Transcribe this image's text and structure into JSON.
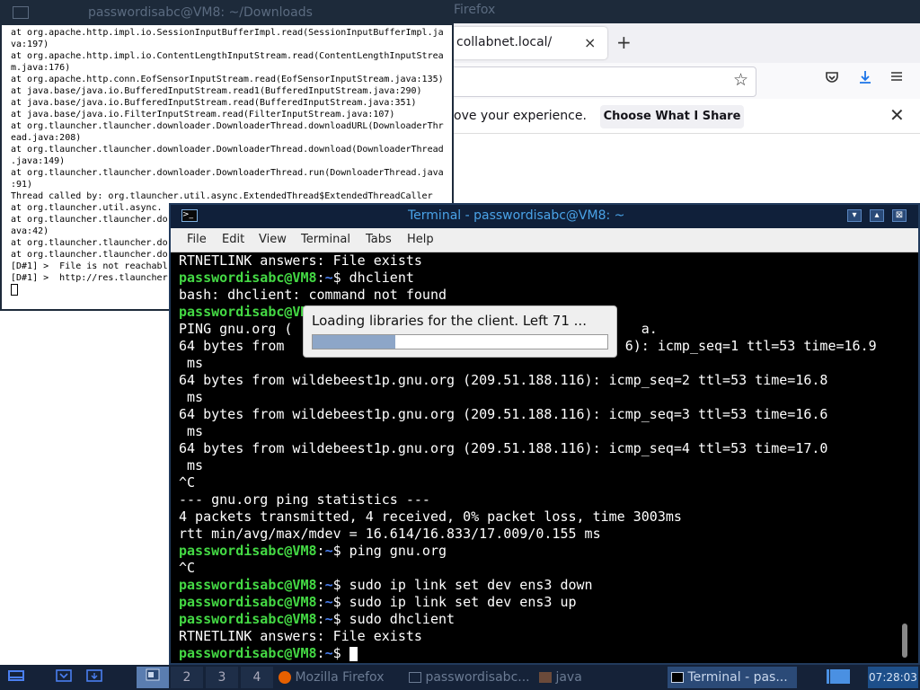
{
  "firefox": {
    "window_title": "Firefox",
    "tab_label": "collabnet.local/",
    "tab_close": "×",
    "new_tab": "+",
    "notification_text": "ove your experience.",
    "choose_button": "Choose What I Share",
    "notification_close": "✕"
  },
  "xterm": {
    "title": "passwordisabc@VM8: ~/Downloads",
    "lines": [
      "at org.apache.http.impl.io.SessionInputBufferImpl.read(SessionInputBufferImpl.ja",
      "va:197)",
      "at org.apache.http.impl.io.ContentLengthInputStream.read(ContentLengthInputStrea",
      "m.java:176)",
      "at org.apache.http.conn.EofSensorInputStream.read(EofSensorInputStream.java:135)",
      "at java.base/java.io.BufferedInputStream.read1(BufferedInputStream.java:290)",
      "at java.base/java.io.BufferedInputStream.read(BufferedInputStream.java:351)",
      "at java.base/java.io.FilterInputStream.read(FilterInputStream.java:107)",
      "at org.tlauncher.tlauncher.downloader.DownloaderThread.downloadURL(DownloaderThr",
      "ead.java:208)",
      "at org.tlauncher.tlauncher.downloader.DownloaderThread.download(DownloaderThread",
      ".java:149)",
      "at org.tlauncher.tlauncher.downloader.DownloaderThread.run(DownloaderThread.java",
      ":91)",
      "Thread called by: org.tlauncher.util.async.ExtendedThread$ExtendedThreadCaller",
      "at org.tlauncher.util.async.",
      "at org.tlauncher.tlauncher.do",
      "ava:42)",
      "at org.tlauncher.tlauncher.do",
      "at org.tlauncher.tlauncher.do",
      "",
      "[D#1] >  File is not reachabl",
      "[D#1] >  http://res.tlauncher"
    ]
  },
  "terminal": {
    "title": "Terminal - passwordisabc@VM8: ~",
    "menu": [
      "File",
      "Edit",
      "View",
      "Terminal",
      "Tabs",
      "Help"
    ],
    "prompt_user": "passwordisabc@VM8",
    "prompt_sep": ":",
    "prompt_path": "~",
    "prompt_end": "$ ",
    "lines": [
      {
        "type": "out",
        "text": "RTNETLINK answers: File exists"
      },
      {
        "type": "cmd",
        "text": "dhclient"
      },
      {
        "type": "out",
        "text": "bash: dhclient: command not found"
      },
      {
        "type": "cmd",
        "text": ""
      },
      {
        "type": "out",
        "text": "PING gnu.org (                                           a."
      },
      {
        "type": "out",
        "text": "64 bytes from                                          6): icmp_seq=1 ttl=53 time=16.9"
      },
      {
        "type": "out",
        "text": " ms"
      },
      {
        "type": "out",
        "text": "64 bytes from wildebeest1p.gnu.org (209.51.188.116): icmp_seq=2 ttl=53 time=16.8"
      },
      {
        "type": "out",
        "text": " ms"
      },
      {
        "type": "out",
        "text": "64 bytes from wildebeest1p.gnu.org (209.51.188.116): icmp_seq=3 ttl=53 time=16.6"
      },
      {
        "type": "out",
        "text": " ms"
      },
      {
        "type": "out",
        "text": "64 bytes from wildebeest1p.gnu.org (209.51.188.116): icmp_seq=4 ttl=53 time=17.0"
      },
      {
        "type": "out",
        "text": " ms"
      },
      {
        "type": "out",
        "text": "^C"
      },
      {
        "type": "out",
        "text": "--- gnu.org ping statistics ---"
      },
      {
        "type": "out",
        "text": "4 packets transmitted, 4 received, 0% packet loss, time 3003ms"
      },
      {
        "type": "out",
        "text": "rtt min/avg/max/mdev = 16.614/16.833/17.009/0.155 ms"
      },
      {
        "type": "cmd",
        "text": "ping gnu.org"
      },
      {
        "type": "out",
        "text": "^C"
      },
      {
        "type": "cmd",
        "text": "sudo ip link set dev ens3 down"
      },
      {
        "type": "cmd",
        "text": "sudo ip link set dev ens3 up"
      },
      {
        "type": "cmd",
        "text": "sudo dhclient"
      },
      {
        "type": "out",
        "text": "RTNETLINK answers: File exists"
      },
      {
        "type": "cmd",
        "text": "",
        "cursor": true
      }
    ]
  },
  "loading": {
    "message": "Loading libraries for the client. Left 71 ...",
    "progress": 0.28
  },
  "taskbar": {
    "workspaces": [
      "1",
      "2",
      "3",
      "4"
    ],
    "windows": [
      {
        "label": "Mozilla Firefox"
      },
      {
        "label": "passwordisabc..."
      },
      {
        "label": "java"
      }
    ],
    "active_window": "Terminal - pas...",
    "clock": "07:28:03"
  },
  "colors": {
    "prompt_user": "#44d944",
    "prompt_path": "#4a7ff0",
    "titlebar": "#1d2a3a",
    "terminal_title": "#4aa3e8",
    "progress_fill": "#8da6c8"
  }
}
